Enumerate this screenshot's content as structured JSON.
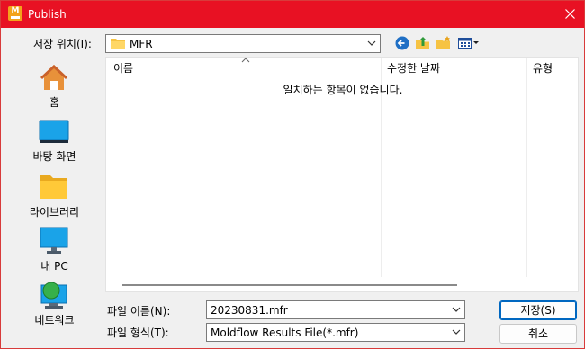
{
  "window": {
    "title": "Publish",
    "app_icon": "moldflow-app-icon"
  },
  "location": {
    "label": "저장 위치(I):",
    "value": "MFR"
  },
  "places": [
    {
      "label": "홈",
      "icon": "home-icon"
    },
    {
      "label": "바탕 화면",
      "icon": "desktop-icon"
    },
    {
      "label": "라이브러리",
      "icon": "library-icon"
    },
    {
      "label": "내 PC",
      "icon": "pc-icon"
    },
    {
      "label": "네트워크",
      "icon": "network-icon"
    }
  ],
  "columns": {
    "name": "이름",
    "modified": "수정한 날짜",
    "type": "유형"
  },
  "empty_message": "일치하는 항목이 없습니다.",
  "filename": {
    "label": "파일 이름(N):",
    "value": "20230831.mfr"
  },
  "filetype": {
    "label": "파일 형식(T):",
    "value": "Moldflow Results File(*.mfr)"
  },
  "buttons": {
    "save": "저장(S)",
    "cancel": "취소"
  },
  "colors": {
    "titlebar": "#e81123",
    "accent": "#0067c0"
  }
}
